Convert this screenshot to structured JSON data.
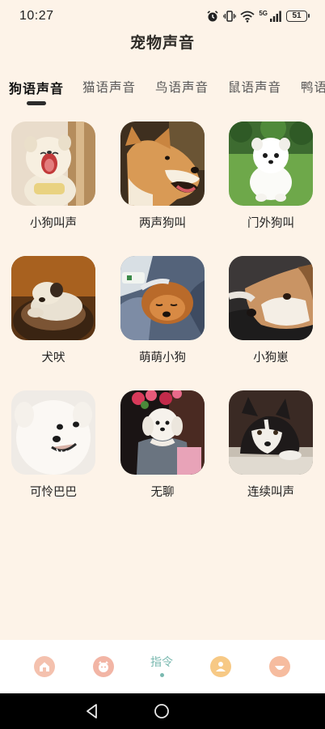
{
  "status": {
    "time": "10:27",
    "battery": "51",
    "network": "5G"
  },
  "header": {
    "title": "宠物声音"
  },
  "tabs": [
    {
      "label": "狗语声音",
      "active": true
    },
    {
      "label": "猫语声音",
      "active": false
    },
    {
      "label": "鸟语声音",
      "active": false
    },
    {
      "label": "鼠语声音",
      "active": false
    },
    {
      "label": "鸭语",
      "active": false
    }
  ],
  "sounds": [
    {
      "label": "小狗叫声",
      "image": "puppy-yawning"
    },
    {
      "label": "两声狗叫",
      "image": "shiba-barking"
    },
    {
      "label": "门外狗叫",
      "image": "white-pomeranian-on-grass"
    },
    {
      "label": "犬吠",
      "image": "puppy-in-basket"
    },
    {
      "label": "萌萌小狗",
      "image": "sleeping-puppy-in-blanket"
    },
    {
      "label": "小狗崽",
      "image": "dog-resting-head"
    },
    {
      "label": "可怜巴巴",
      "image": "smiling-white-spitz"
    },
    {
      "label": "无聊",
      "image": "maltese-with-flowers"
    },
    {
      "label": "连续叫声",
      "image": "husky-lying-down"
    }
  ],
  "bottom_nav": [
    {
      "icon": "home-icon",
      "label": "",
      "color": "#f0b3a0"
    },
    {
      "icon": "cat-face-icon",
      "label": "",
      "color": "#f0b3a0"
    },
    {
      "icon": "",
      "label": "指令",
      "color": "#7ab9b0"
    },
    {
      "icon": "photo-icon",
      "label": "",
      "color": "#f5c27a"
    },
    {
      "icon": "smile-icon",
      "label": "",
      "color": "#f3b69a"
    }
  ],
  "system_nav": [
    "back-icon",
    "home-circle-icon"
  ]
}
